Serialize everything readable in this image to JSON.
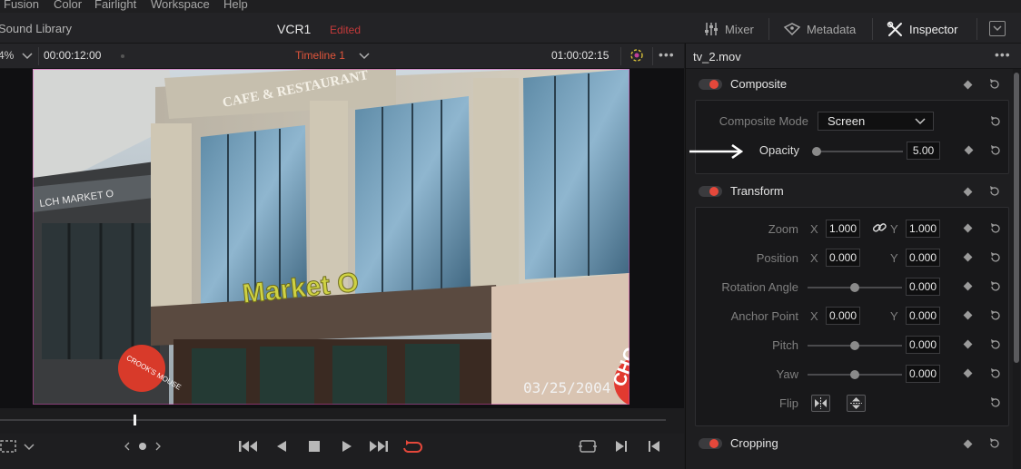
{
  "menu": [
    "Fusion",
    "Color",
    "Fairlight",
    "Workspace",
    "Help"
  ],
  "topbar": {
    "library": "Sound Library",
    "project": "VCR1",
    "status": "Edited",
    "mixer": "Mixer",
    "metadata": "Metadata",
    "inspector": "Inspector"
  },
  "viewer": {
    "zoom": "4%",
    "timecode_left": "00:00:12:00",
    "timeline": "Timeline 1",
    "timecode_right": "01:00:02:15",
    "playhead_fraction": 0.2,
    "frame": {
      "sign_top": "CAFE & RESTAURANT",
      "sign_side": "LCH MARKET O",
      "sign_main": "Market O",
      "date_stamp": "03/25/2004",
      "round_sign": "CROOK'S MOUSE",
      "edge_sign": "CHO"
    }
  },
  "inspector": {
    "filename": "tv_2.mov",
    "composite": {
      "title": "Composite",
      "mode_label": "Composite Mode",
      "mode_value": "Screen",
      "opacity_label": "Opacity",
      "opacity_value": "5.00"
    },
    "transform": {
      "title": "Transform",
      "zoom_label": "Zoom",
      "zoom_x": "1.000",
      "zoom_y": "1.000",
      "position_label": "Position",
      "position_x": "0.000",
      "position_y": "0.000",
      "rotation_label": "Rotation Angle",
      "rotation_value": "0.000",
      "anchor_label": "Anchor Point",
      "anchor_x": "0.000",
      "anchor_y": "0.000",
      "pitch_label": "Pitch",
      "pitch_value": "0.000",
      "yaw_label": "Yaw",
      "yaw_value": "0.000",
      "flip_label": "Flip",
      "x": "X",
      "y": "Y"
    },
    "cropping": {
      "title": "Cropping"
    }
  },
  "colors": {
    "accent_red": "#e5483b",
    "timeline_red": "#e0553b",
    "edited_red": "#c43a3a"
  }
}
